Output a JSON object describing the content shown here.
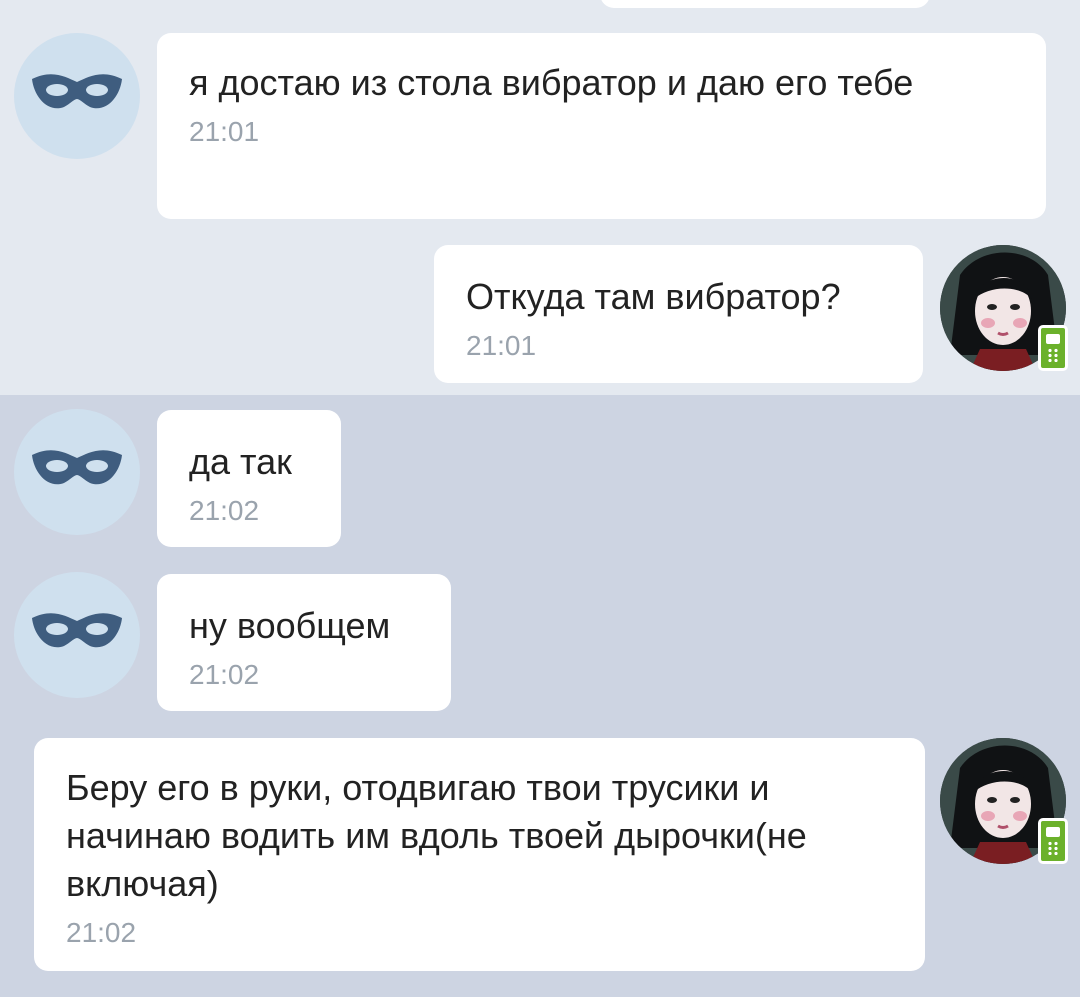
{
  "colors": {
    "band_top": "#e4e9f0",
    "band_bottom": "#cdd4e2",
    "bubble": "#ffffff",
    "text": "#222222",
    "time": "#9aa3ad",
    "anon_avatar_bg": "#cfe0ee",
    "mask_color": "#3f5d7f",
    "online_mobile": "#6bb12b"
  },
  "messages": [
    {
      "sender": "anonymous",
      "avatar_icon": "mask-icon",
      "text": "я достаю из стола вибратор и даю его тебе",
      "time": "21:01"
    },
    {
      "sender": "user",
      "avatar_icon": "user-photo",
      "text": "Откуда там вибратор?",
      "time": "21:01",
      "status_icon": "mobile-online-icon"
    },
    {
      "sender": "anonymous",
      "avatar_icon": "mask-icon",
      "text": "да так",
      "time": "21:02"
    },
    {
      "sender": "anonymous",
      "avatar_icon": "mask-icon",
      "text": "ну вообщем",
      "time": "21:02"
    },
    {
      "sender": "user",
      "avatar_icon": "user-photo",
      "text": "Беру его в руки, отодвигаю твои трусики и начинаю водить им вдоль твоей дырочки(не включая)",
      "time": "21:02",
      "status_icon": "mobile-online-icon"
    }
  ]
}
